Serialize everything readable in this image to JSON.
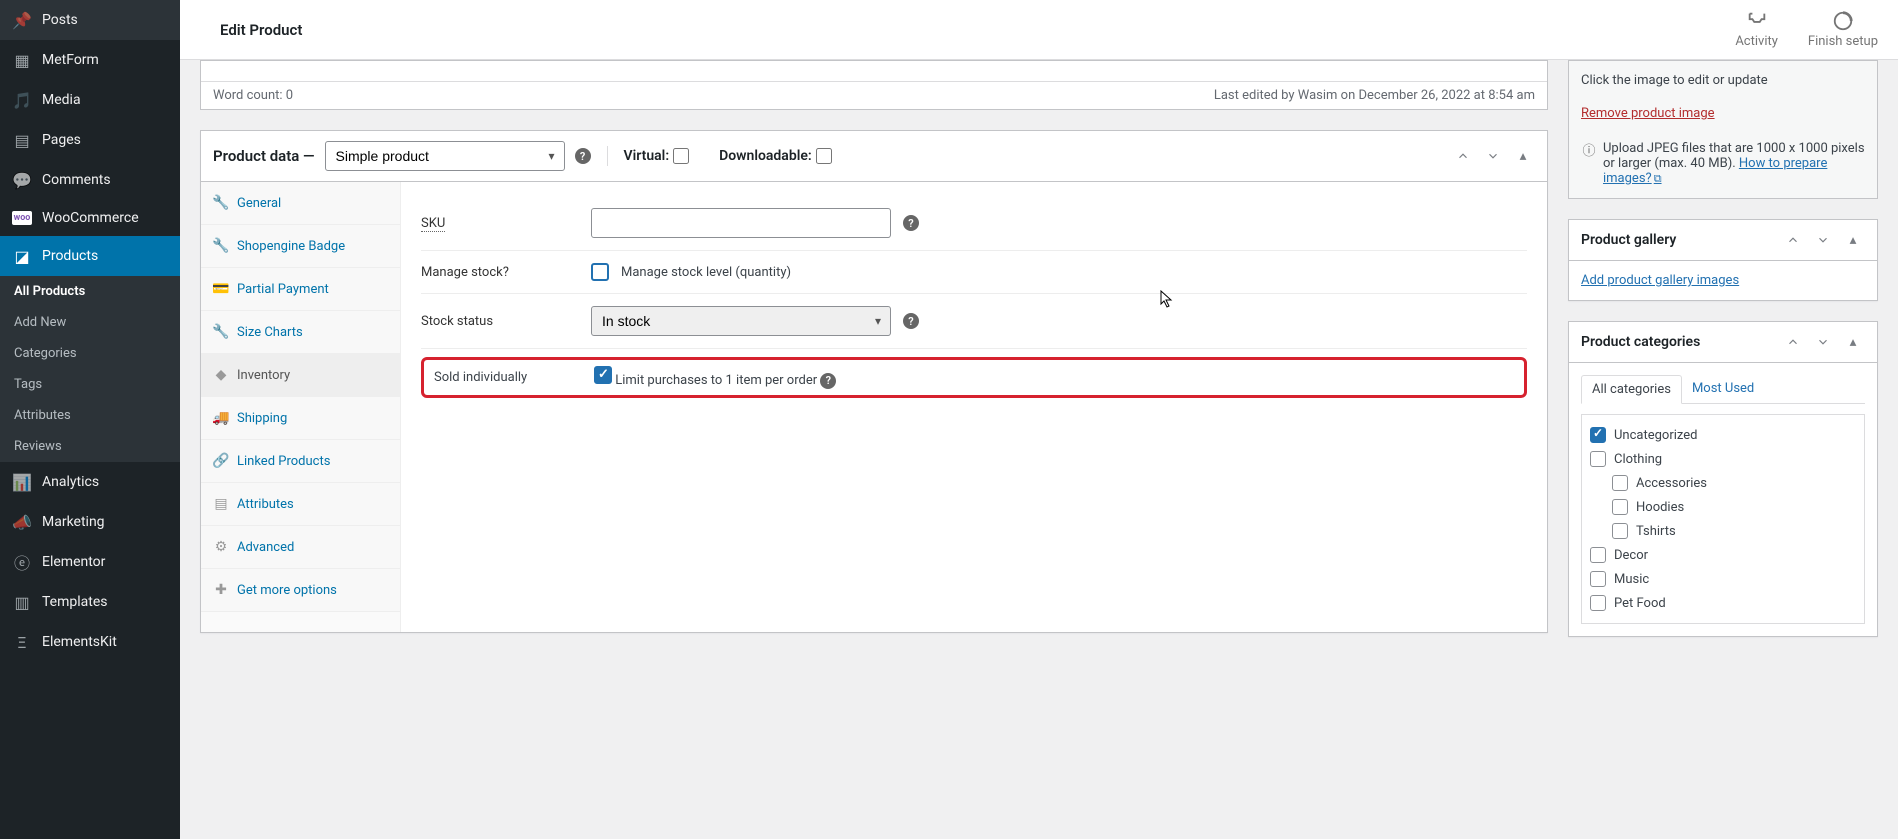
{
  "topbar": {
    "title": "Edit Product",
    "activity_label": "Activity",
    "finish_label": "Finish setup"
  },
  "adminMenu": {
    "posts": "Posts",
    "metform": "MetForm",
    "media": "Media",
    "pages": "Pages",
    "comments": "Comments",
    "woocommerce": "WooCommerce",
    "products": "Products",
    "analytics": "Analytics",
    "marketing": "Marketing",
    "elementor": "Elementor",
    "templates": "Templates",
    "elementskit": "ElementsKit"
  },
  "productsSubmenu": {
    "all": "All Products",
    "add": "Add New",
    "categories": "Categories",
    "tags": "Tags",
    "attributes": "Attributes",
    "reviews": "Reviews"
  },
  "editor": {
    "word_count": "Word count: 0",
    "last_edited": "Last edited by Wasim on December 26, 2022 at 8:54 am"
  },
  "productData": {
    "heading": "Product data —",
    "type_selected": "Simple product",
    "virtual_label": "Virtual:",
    "downloadable_label": "Downloadable:",
    "tabs": {
      "general": "General",
      "shopengine": "Shopengine Badge",
      "partial": "Partial Payment",
      "size_charts": "Size Charts",
      "inventory": "Inventory",
      "shipping": "Shipping",
      "linked": "Linked Products",
      "attributes": "Attributes",
      "advanced": "Advanced",
      "get_more": "Get more options"
    },
    "inventory": {
      "sku_label": "SKU",
      "sku_value": "",
      "manage_stock_label": "Manage stock?",
      "manage_stock_text": "Manage stock level (quantity)",
      "stock_status_label": "Stock status",
      "stock_status_value": "In stock",
      "sold_individually_label": "Sold individually",
      "sold_individually_text": "Limit purchases to 1 item per order"
    }
  },
  "productImage": {
    "click_text": "Click the image to edit or update",
    "remove_link": "Remove product image",
    "upload_note_prefix": "Upload JPEG files that are 1000 x 1000 pixels or larger (max. 40 MB). ",
    "how_link": "How to prepare images?"
  },
  "gallery": {
    "title": "Product gallery",
    "add_link": "Add product gallery images"
  },
  "categories": {
    "title": "Product categories",
    "tab_all": "All categories",
    "tab_most": "Most Used",
    "items": {
      "uncategorized": "Uncategorized",
      "clothing": "Clothing",
      "accessories": "Accessories",
      "hoodies": "Hoodies",
      "tshirts": "Tshirts",
      "decor": "Decor",
      "music": "Music",
      "petfood": "Pet Food"
    }
  }
}
